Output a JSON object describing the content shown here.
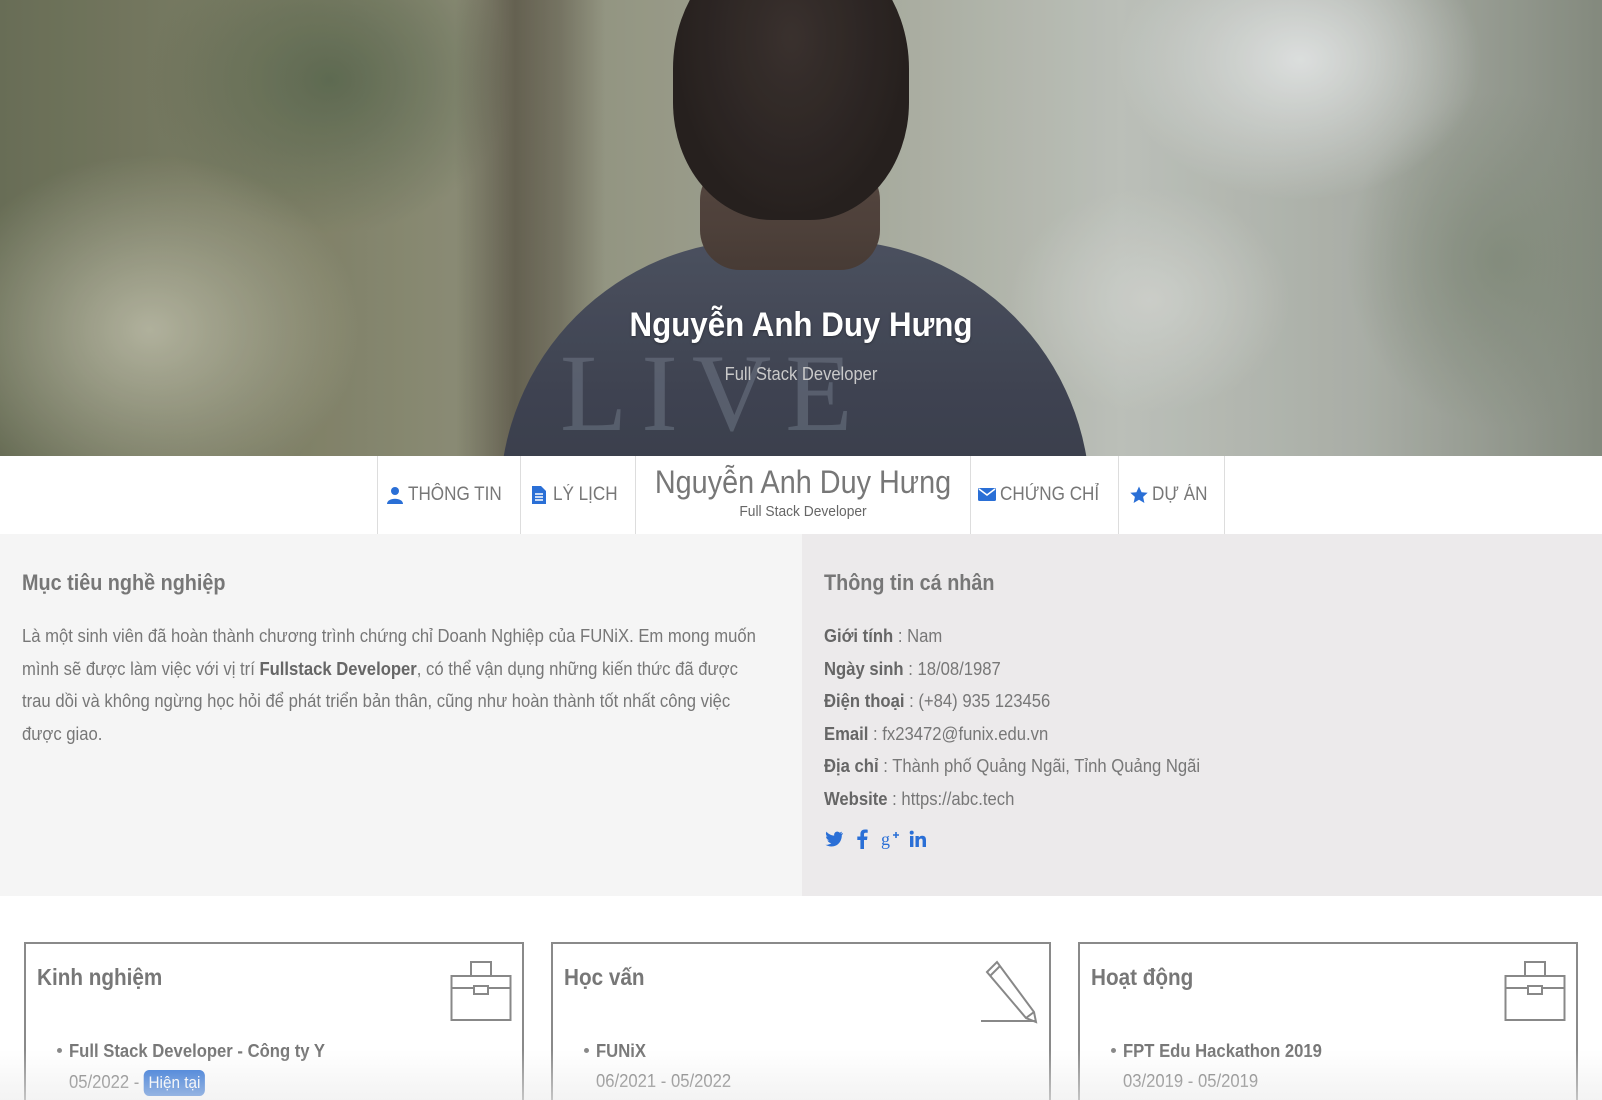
{
  "hero": {
    "name": "Nguyễn Anh Duy Hưng",
    "title": "Full Stack Developer"
  },
  "nav": {
    "items": [
      {
        "label": "THÔNG TIN",
        "icon": "user-icon"
      },
      {
        "label": "LÝ LỊCH",
        "icon": "file-icon"
      },
      {
        "label": "CHỨNG CHỈ",
        "icon": "envelope-icon"
      },
      {
        "label": "DỰ ÁN",
        "icon": "star-icon"
      }
    ],
    "brand_name": "Nguyễn Anh Duy Hưng",
    "brand_title": "Full Stack Developer"
  },
  "objective": {
    "heading": "Mục tiêu nghề nghiệp",
    "text_before": "Là một sinh viên đã hoàn thành chương trình chứng chỉ Doanh Nghiệp của FUNiX. Em mong muốn mình sẽ được làm việc với vị trí ",
    "text_bold": "Fullstack Developer",
    "text_after": ", có thể vận dụng những kiến thức đã được trau dồi và không ngừng học hỏi để phát triển bản thân, cũng như hoàn thành tốt nhất công việc được giao."
  },
  "personal": {
    "heading": "Thông tin cá nhân",
    "rows": [
      {
        "label": "Giới tính",
        "value": "Nam"
      },
      {
        "label": "Ngày sinh",
        "value": "18/08/1987"
      },
      {
        "label": "Điện thoại",
        "value": "(+84) 935 123456"
      },
      {
        "label": "Email",
        "value": "fx23472@funix.edu.vn"
      },
      {
        "label": "Địa chỉ",
        "value": "Thành phố Quảng Ngãi, Tỉnh Quảng Ngãi"
      },
      {
        "label": "Website",
        "value": "https://abc.tech"
      }
    ],
    "socials": [
      "twitter-icon",
      "facebook-icon",
      "google-plus-icon",
      "linkedin-icon"
    ]
  },
  "cards": [
    {
      "title": "Kinh nghiệm",
      "icon": "briefcase-icon",
      "item_name": "Full Stack Developer - Công ty Y",
      "item_date": "05/2022 - ",
      "badge": "Hiện tại"
    },
    {
      "title": "Học vấn",
      "icon": "pencil-icon",
      "item_name": "FUNiX",
      "item_date": "06/2021 - 05/2022"
    },
    {
      "title": "Hoạt động",
      "icon": "briefcase-icon",
      "item_name": "FPT Edu Hackathon 2019",
      "item_date": "03/2019 - 05/2019"
    }
  ],
  "colors": {
    "accent": "#2a6fd6",
    "text": "#777777",
    "left_panel_bg": "#f5f5f5",
    "right_panel_bg": "#eceaeb"
  }
}
